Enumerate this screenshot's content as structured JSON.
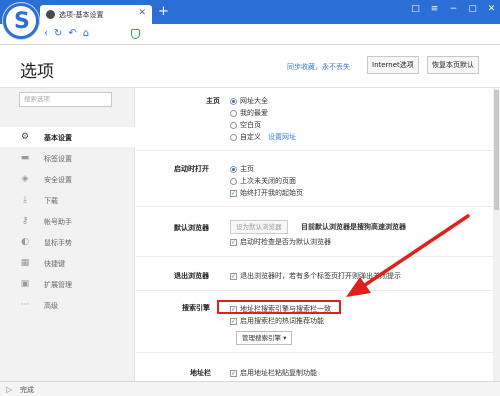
{
  "tab": {
    "title": "选项-基本设置"
  },
  "window": {
    "buttons": [
      "□",
      "≡",
      "−",
      "▢",
      "✕"
    ]
  },
  "header": {
    "title": "选项",
    "sync_text": "同步收藏，永不丢失",
    "internet_options": "Internet选项",
    "restore_defaults": "恢复本页默认"
  },
  "sidebar": {
    "search_placeholder": "搜索选项",
    "items": [
      {
        "label": "基本设置",
        "icon": "gear-icon"
      },
      {
        "label": "标签设置",
        "icon": "tab-icon"
      },
      {
        "label": "安全设置",
        "icon": "shield-icon"
      },
      {
        "label": "下载",
        "icon": "download-icon"
      },
      {
        "label": "帐号助手",
        "icon": "key-icon"
      },
      {
        "label": "鼠标手势",
        "icon": "mouse-icon"
      },
      {
        "label": "快捷键",
        "icon": "keyboard-icon"
      },
      {
        "label": "扩展管理",
        "icon": "extension-icon"
      },
      {
        "label": "高级",
        "icon": "more-icon"
      }
    ]
  },
  "homepage": {
    "label": "主页",
    "options": [
      "网址大全",
      "我的最爱",
      "空白页",
      "自定义"
    ],
    "set_url": "设置网址"
  },
  "startup": {
    "label": "启动时打开",
    "options": [
      "主页",
      "上次未关闭的页面"
    ],
    "checkbox": "始终打开我的起始页"
  },
  "default_browser": {
    "label": "默认浏览器",
    "button": "设为默认浏览器",
    "status": "目前默认浏览器是搜狗高速浏览器",
    "checkbox": "启动时检查是否为默认浏览器"
  },
  "exit": {
    "label": "退出浏览器",
    "checkbox": "退出浏览器时，若有多个标签页打开则弹出关闭提示"
  },
  "search_engine": {
    "label": "搜索引擎",
    "checkbox1": "地址栏搜索引擎与搜索栏一致",
    "checkbox2": "启用搜索栏的热词推荐功能",
    "dropdown": "管理搜索引擎"
  },
  "address_bar": {
    "label": "地址栏",
    "checkbox": "启用地址栏粘贴复制功能"
  },
  "status": {
    "text": "完成"
  },
  "colors": {
    "accent": "#2b6fd6",
    "highlight": "#e0201a"
  }
}
